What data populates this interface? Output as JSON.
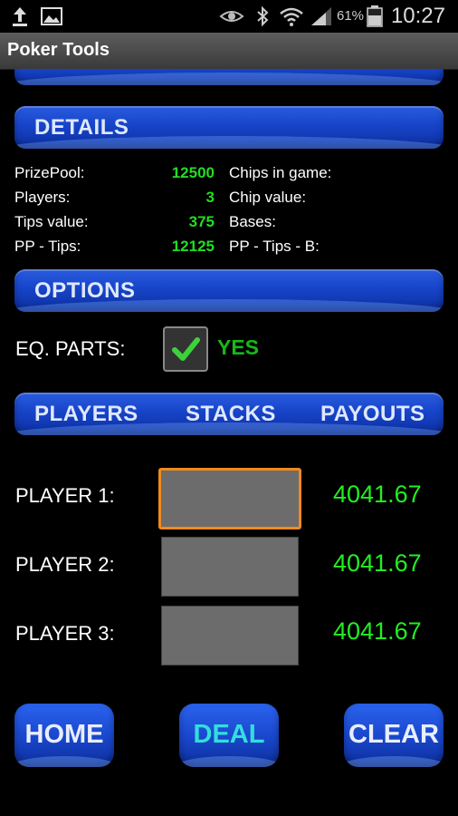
{
  "status": {
    "battery_pct": "61%",
    "time": "10:27"
  },
  "app": {
    "title": "Poker Tools"
  },
  "details": {
    "header": "DETAILS",
    "rows": [
      {
        "label": "PrizePool:",
        "value": "12500",
        "right_label": "Chips in game:"
      },
      {
        "label": "Players:",
        "value": "3",
        "right_label": "Chip value:"
      },
      {
        "label": "Tips value:",
        "value": "375",
        "right_label": "Bases:"
      },
      {
        "label": "PP - Tips:",
        "value": "12125",
        "right_label": "PP - Tips - B:"
      }
    ]
  },
  "options": {
    "header": "OPTIONS",
    "eq_parts_label": "EQ. PARTS:",
    "eq_parts_value": "YES"
  },
  "tabs": {
    "players": "PLAYERS",
    "stacks": "STACKS",
    "payouts": "PAYOUTS"
  },
  "players": [
    {
      "label": "PLAYER 1:",
      "stack": "",
      "payout": "4041.67"
    },
    {
      "label": "PLAYER 2:",
      "stack": "",
      "payout": "4041.67"
    },
    {
      "label": "PLAYER 3:",
      "stack": "",
      "payout": "4041.67"
    }
  ],
  "buttons": {
    "home": "HOME",
    "deal": "DEAL",
    "clear": "CLEAR"
  },
  "colors": {
    "accent_blue": "#1a48cf",
    "value_green": "#22dd22",
    "focus_orange": "#f08a1c",
    "deal_text": "#33dddd"
  },
  "icons": [
    "upload-icon",
    "image-icon",
    "eye-icon",
    "bluetooth-icon",
    "wifi-icon",
    "signal-icon",
    "battery-icon",
    "check-icon"
  ]
}
